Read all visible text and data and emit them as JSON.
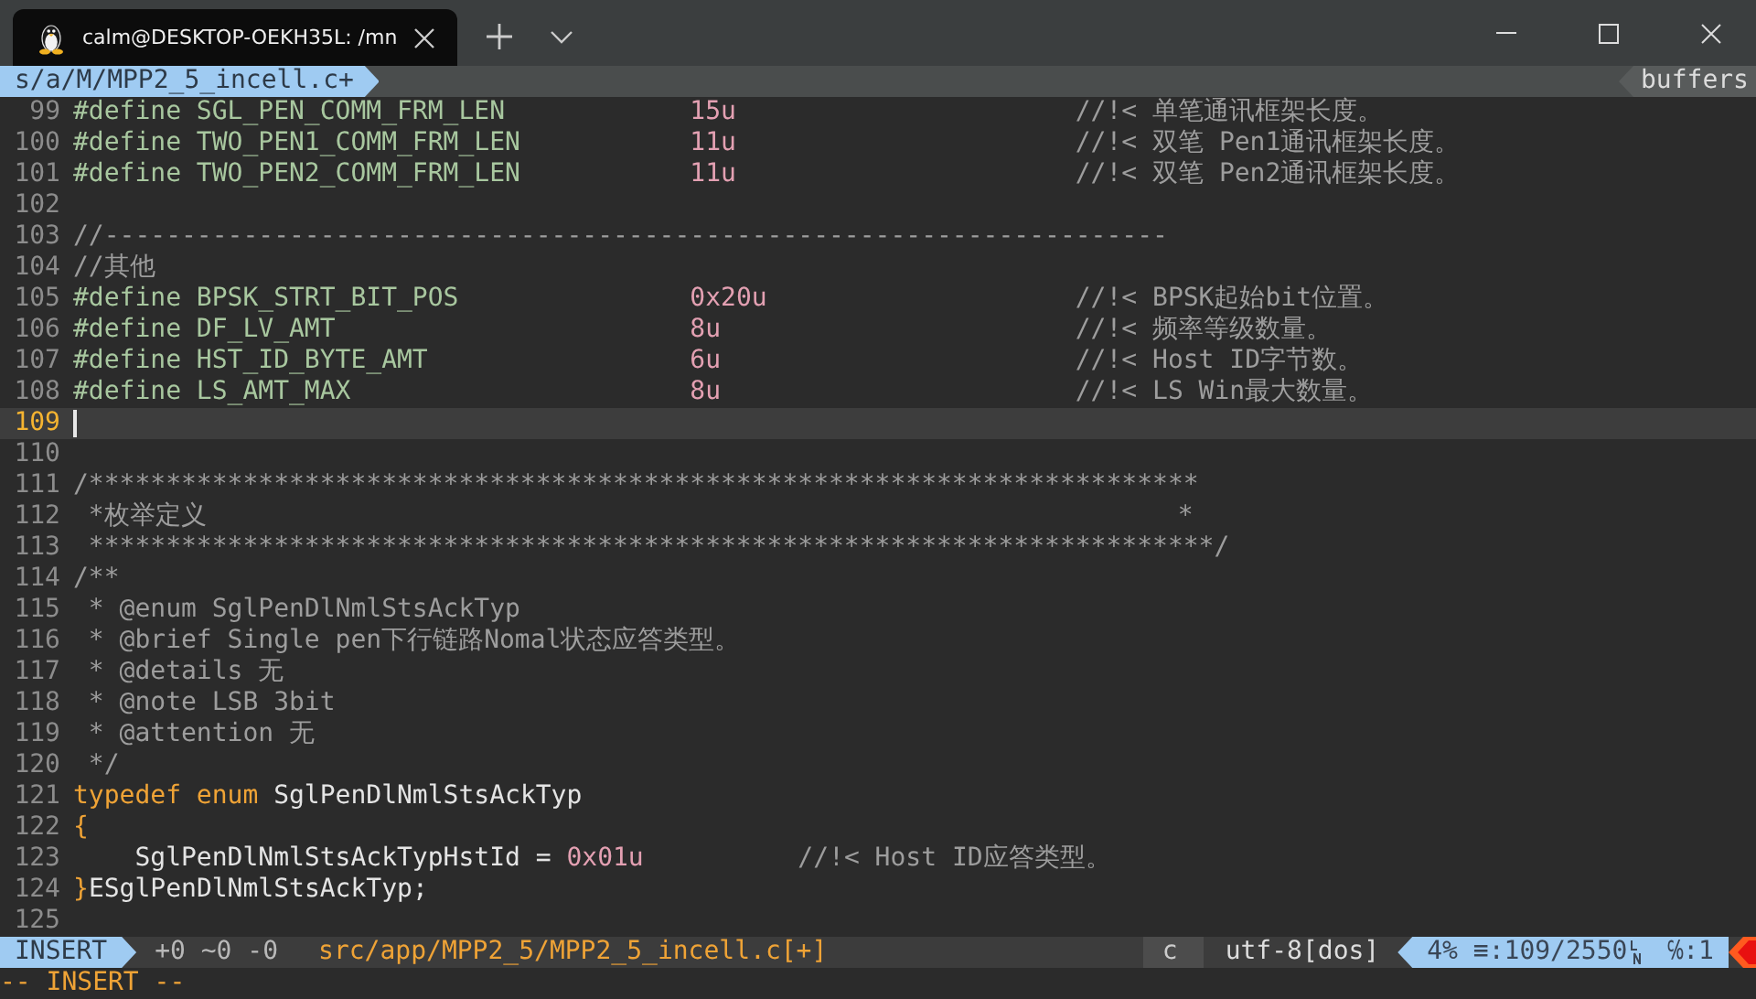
{
  "window": {
    "tab_title": "calm@DESKTOP-OEKH35L: /mn"
  },
  "tabline": {
    "buffer": "s/a/M/MPP2_5_incell.c+",
    "right_label": "buffers"
  },
  "editor": {
    "lines": [
      {
        "number": "99",
        "current": false,
        "segments": [
          {
            "kind": "define",
            "text": "#define SGL_PEN_COMM_FRM_LEN            "
          },
          {
            "kind": "number",
            "text": "15u                      "
          },
          {
            "kind": "comment",
            "text": "//!< 单笔通讯框架长度。"
          }
        ]
      },
      {
        "number": "100",
        "current": false,
        "segments": [
          {
            "kind": "define",
            "text": "#define TWO_PEN1_COMM_FRM_LEN           "
          },
          {
            "kind": "number",
            "text": "11u                      "
          },
          {
            "kind": "comment",
            "text": "//!< 双笔 Pen1通讯框架长度。"
          }
        ]
      },
      {
        "number": "101",
        "current": false,
        "segments": [
          {
            "kind": "define",
            "text": "#define TWO_PEN2_COMM_FRM_LEN           "
          },
          {
            "kind": "number",
            "text": "11u                      "
          },
          {
            "kind": "comment",
            "text": "//!< 双笔 Pen2通讯框架长度。"
          }
        ]
      },
      {
        "number": "102",
        "current": false
      },
      {
        "number": "103",
        "current": false,
        "segments": [
          {
            "kind": "comment",
            "text": "//---------------------------------------------------------------------"
          }
        ]
      },
      {
        "number": "104",
        "current": false,
        "segments": [
          {
            "kind": "comment",
            "text": "//其他"
          }
        ]
      },
      {
        "number": "105",
        "current": false,
        "segments": [
          {
            "kind": "define",
            "text": "#define BPSK_STRT_BIT_POS               "
          },
          {
            "kind": "number",
            "text": "0x20u                    "
          },
          {
            "kind": "comment",
            "text": "//!< BPSK起始bit位置。"
          }
        ]
      },
      {
        "number": "106",
        "current": false,
        "segments": [
          {
            "kind": "define",
            "text": "#define DF_LV_AMT                       "
          },
          {
            "kind": "number",
            "text": "8u                       "
          },
          {
            "kind": "comment",
            "text": "//!< 频率等级数量。"
          }
        ]
      },
      {
        "number": "107",
        "current": false,
        "segments": [
          {
            "kind": "define",
            "text": "#define HST_ID_BYTE_AMT                 "
          },
          {
            "kind": "number",
            "text": "6u                       "
          },
          {
            "kind": "comment",
            "text": "//!< Host ID字节数。"
          }
        ]
      },
      {
        "number": "108",
        "current": false,
        "segments": [
          {
            "kind": "define",
            "text": "#define LS_AMT_MAX                      "
          },
          {
            "kind": "number",
            "text": "8u                       "
          },
          {
            "kind": "comment",
            "text": "//!< LS Win最大数量。"
          }
        ]
      },
      {
        "number": "109",
        "current": true
      },
      {
        "number": "110",
        "current": false
      },
      {
        "number": "111",
        "current": false,
        "segments": [
          {
            "kind": "comment",
            "text": "/************************************************************************"
          }
        ]
      },
      {
        "number": "112",
        "current": false,
        "segments": [
          {
            "kind": "comment",
            "text": " *枚举定义                                                               *"
          }
        ]
      },
      {
        "number": "113",
        "current": false,
        "segments": [
          {
            "kind": "comment",
            "text": " *************************************************************************/"
          }
        ]
      },
      {
        "number": "114",
        "current": false,
        "segments": [
          {
            "kind": "comment",
            "text": "/**"
          }
        ]
      },
      {
        "number": "115",
        "current": false,
        "segments": [
          {
            "kind": "comment",
            "text": " * @enum SglPenDlNmlStsAckTyp"
          }
        ]
      },
      {
        "number": "116",
        "current": false,
        "segments": [
          {
            "kind": "comment",
            "text": " * @brief Single pen下行链路Nomal状态应答类型。"
          }
        ]
      },
      {
        "number": "117",
        "current": false,
        "segments": [
          {
            "kind": "comment",
            "text": " * @details 无"
          }
        ]
      },
      {
        "number": "118",
        "current": false,
        "segments": [
          {
            "kind": "comment",
            "text": " * @note LSB 3bit"
          }
        ]
      },
      {
        "number": "119",
        "current": false,
        "segments": [
          {
            "kind": "comment",
            "text": " * @attention 无"
          }
        ]
      },
      {
        "number": "120",
        "current": false,
        "segments": [
          {
            "kind": "comment",
            "text": " */"
          }
        ]
      },
      {
        "number": "121",
        "current": false,
        "segments": [
          {
            "kind": "keyword",
            "text": "typedef enum "
          },
          {
            "kind": "plain",
            "text": "SglPenDlNmlStsAckTyp"
          }
        ]
      },
      {
        "number": "122",
        "current": false,
        "segments": [
          {
            "kind": "keyword",
            "text": "{"
          }
        ]
      },
      {
        "number": "123",
        "current": false,
        "segments": [
          {
            "kind": "plain",
            "text": "    SglPenDlNmlStsAckTypHstId = "
          },
          {
            "kind": "number",
            "text": "0x01u          "
          },
          {
            "kind": "comment",
            "text": "//!< Host ID应答类型。"
          }
        ]
      },
      {
        "number": "124",
        "current": false,
        "segments": [
          {
            "kind": "keyword",
            "text": "}"
          },
          {
            "kind": "plain",
            "text": "ESglPenDlNmlStsAckTyp;"
          }
        ]
      },
      {
        "number": "125",
        "current": false
      }
    ]
  },
  "statusline": {
    "mode": "INSERT",
    "hunks": "+0 ~0 -0",
    "file": "src/app/MPP2_5/MPP2_5_incell.c[+]",
    "filetype": "c",
    "encoding": "utf-8[dos]",
    "position": "4% ≡:109/2550",
    "column": "℅:1"
  },
  "command_line": "-- INSERT --"
}
